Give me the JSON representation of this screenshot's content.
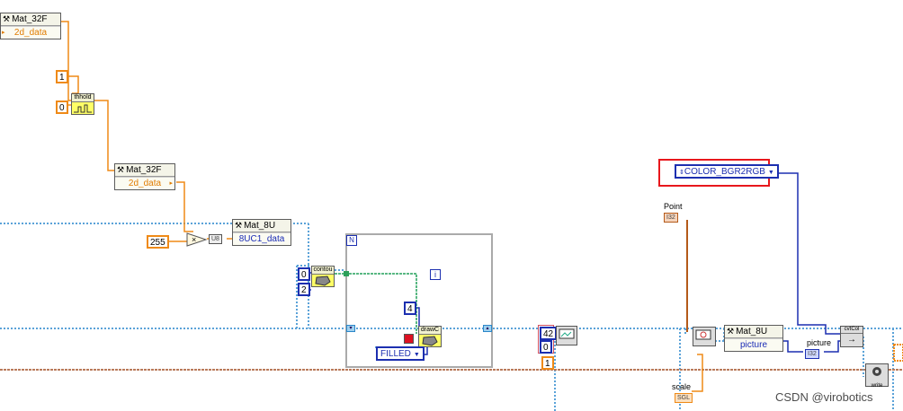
{
  "wires": {
    "image_ref": "#5aa2d8",
    "integer": "#1c2fb0",
    "float": "#ef8a17",
    "point": "#b45a1a",
    "error": "#a06a3a"
  },
  "nodes": {
    "mat32f_a": {
      "class": "Mat_32F",
      "prop": "2d_data"
    },
    "mat32f_b": {
      "class": "Mat_32F",
      "prop": "2d_data"
    },
    "mat8u_a": {
      "class": "Mat_8U",
      "prop": "8UC1_data"
    },
    "mat8u_b": {
      "class": "Mat_8U",
      "prop": "picture"
    },
    "threshold_vi": "thhold",
    "contour_vi": "contou",
    "drawc_vi": "drawC",
    "cvtcol_vi": "cvtCol",
    "write_vi": "write",
    "u8_conv": "U8",
    "multiply": "×"
  },
  "constants": {
    "c_1_top": "1",
    "c_0_top": "0",
    "c_255": "255",
    "c_0_mid": "0",
    "c_2": "2",
    "c_4": "4",
    "c_42": "42",
    "c_0_right": "0",
    "c_1_bottom": "1",
    "filled_enum": "FILLED",
    "color_enum": "COLOR_BGR2RGB"
  },
  "loop": {
    "count_terminal": "N",
    "iteration_terminal": "i"
  },
  "labels": {
    "point": "Point",
    "scale": "scale",
    "picture": "picture"
  },
  "indicators": {
    "point_ind": "I32",
    "scale_ind": "SGL",
    "picture_ind": "I32"
  },
  "watermark": "CSDN @virobotics"
}
